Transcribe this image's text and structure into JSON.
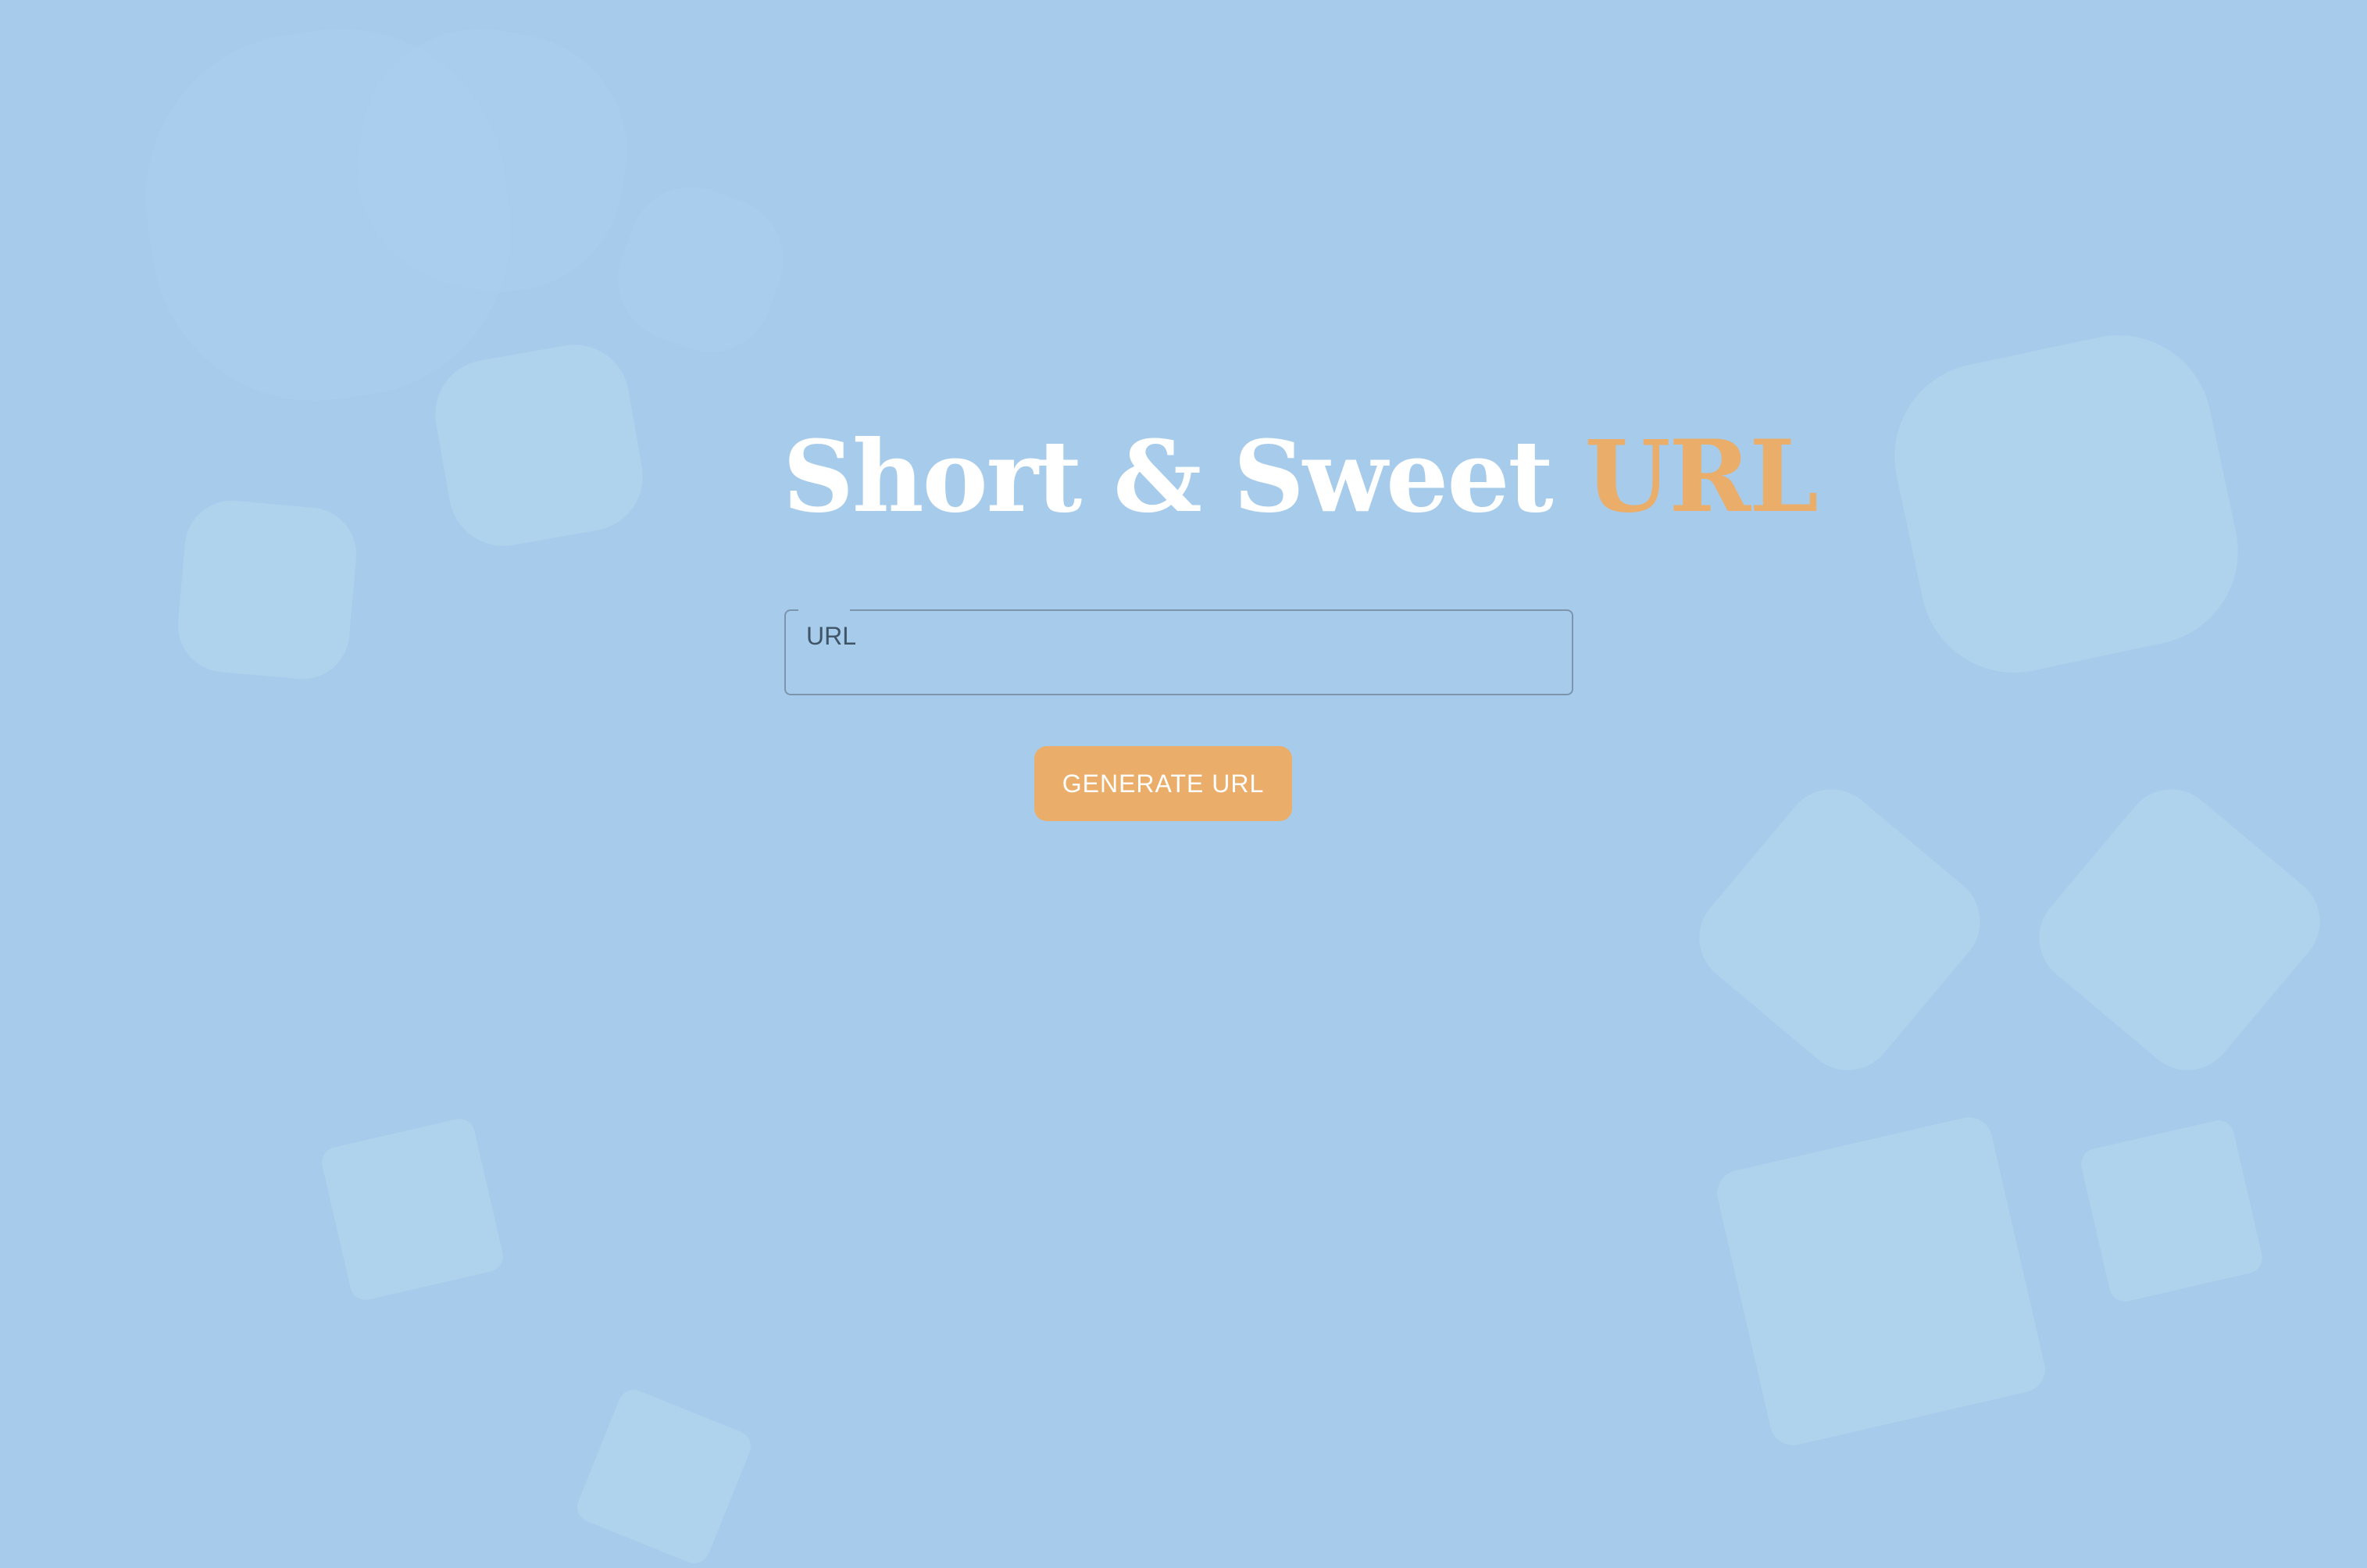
{
  "header": {
    "title_main": "Short & Sweet",
    "title_accent": "URL"
  },
  "form": {
    "url_label": "URL",
    "url_value": "",
    "generate_label": "GENERATE URL"
  },
  "colors": {
    "background": "#a6cbeb",
    "accent": "#eaae6a",
    "title": "#ffffff"
  }
}
